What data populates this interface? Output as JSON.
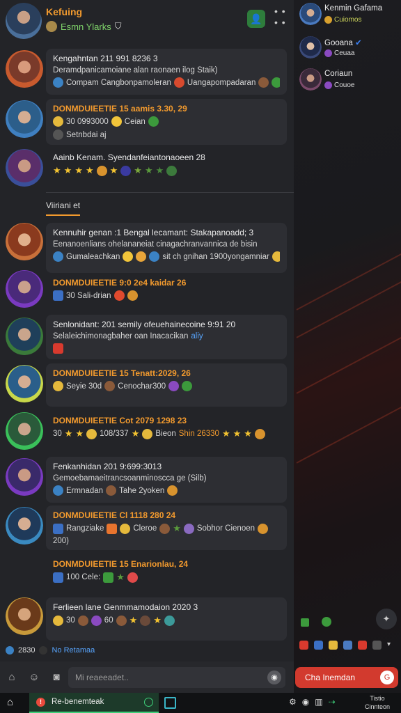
{
  "header": {
    "title": "Kefuing",
    "subtitle": "Esmn Ylarks",
    "menu_icon": "vertical-dots-icon"
  },
  "messages": [
    {
      "name": "Kengahntan 211 991 8236 3",
      "lines": [
        "Deramdpanicamoiane alan raonaen ilog Staik)",
        "Compam  Cangbonpamoleran"
      ]
    },
    {
      "name": "DONMDUIEETIE 15 aamis 3.30, 29",
      "orange": true,
      "lines": [
        "30  0993000",
        "Setnbdai aj"
      ],
      "extra": "Ceian"
    },
    {
      "name": "Aainb Kenam. Syendanfeiantonaoeen 28",
      "lines": [
        ""
      ]
    },
    {
      "name": "Kennuhir genan :1 Bengal lecamant: Stakapanoadd; 3",
      "lines": [
        "Eenanoenlians ohelananeiat cinagachranvannica de bisin",
        "Gumaleachkan",
        "sit ch gnihan 1900yongamniar"
      ]
    },
    {
      "name": "DONMDUIEETIE 9:0 2e4 kaidar 26",
      "orange": true,
      "lines": [
        "30  Sali-drian"
      ]
    },
    {
      "name": "Senlonidant: 201 semily ofeuehainecoine 9:91 20",
      "lines": [
        "Selaleichimonagbaher oan Inacacikan",
        "aliy"
      ]
    },
    {
      "name": "DONMDUIEETIE 15 Tenatt:2029, 26",
      "orange": true,
      "lines": [
        "Seyie 30d",
        "Cenochar300"
      ]
    },
    {
      "name": "DONMDUIEETIE Cot 2079 1298 23",
      "orange": true,
      "lines": [
        "30",
        "108/337",
        "Bieon",
        "Shin 26330"
      ]
    },
    {
      "name": "Fenkanhidan  201 9:699:3013",
      "lines": [
        "Gemoebamaeitrancsoanminoscca ge (Silb)",
        "Ermnadan",
        "Tahe 2yoken"
      ]
    },
    {
      "name": "DONMDUIEETIE  Cl 1118 280 24",
      "orange": true,
      "lines": [
        "Rangziake",
        "Cleroe",
        "Sobhor Cienoen",
        "200)"
      ]
    },
    {
      "name": "DONMDUIEETIE 15 Enarionlau, 24",
      "orange": true,
      "lines": [
        "100 Cele:"
      ]
    },
    {
      "name": "Ferlieen lane Genmmamodaion 2020 3",
      "lines": [
        ""
      ]
    }
  ],
  "section_label": "Viiriani et",
  "typing": {
    "left": "2830",
    "text": "No Retamaa"
  },
  "composer": {
    "placeholder": "Mi reaeeadet.."
  },
  "contacts": [
    {
      "name": "Kenmin Gafama",
      "status": "Cuiomos"
    },
    {
      "name": "Gooana",
      "status": "Ceuaa"
    },
    {
      "name": "Coriaun",
      "status": "Couoe"
    }
  ],
  "action_button": {
    "label": "Cha Inemdan",
    "icon": "G"
  },
  "taskbar": {
    "app_label": "Re-benemteak",
    "clock_line1": "Tistio",
    "clock_line2": "Cinnteon"
  },
  "colors": {
    "accent": "#f29a2e",
    "green": "#3fd07a",
    "red": "#d23a2e",
    "link": "#58a6ff"
  }
}
